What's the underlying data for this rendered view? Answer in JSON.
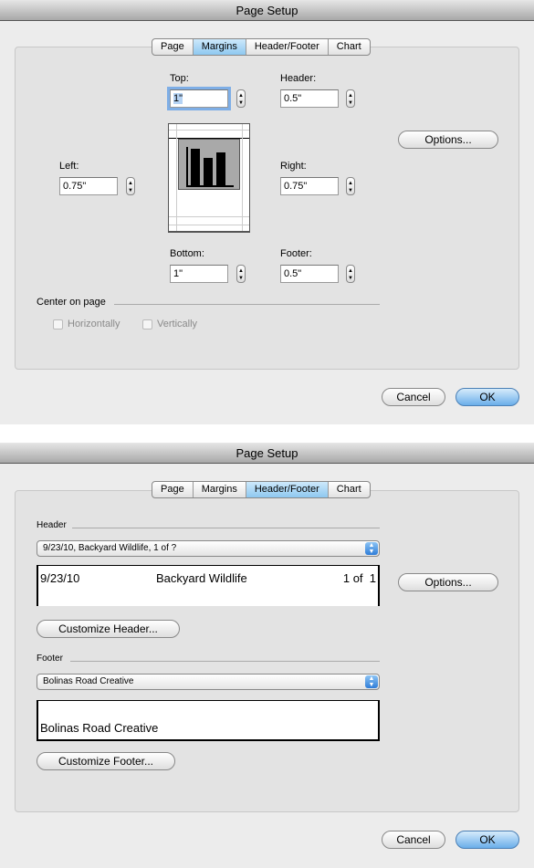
{
  "dialog1": {
    "title": "Page Setup",
    "tabs": [
      "Page",
      "Margins",
      "Header/Footer",
      "Chart"
    ],
    "selected_tab": "Margins",
    "top_label": "Top:",
    "top_value": "1\"",
    "header_label": "Header:",
    "header_value": "0.5\"",
    "left_label": "Left:",
    "left_value": "0.75\"",
    "right_label": "Right:",
    "right_value": "0.75\"",
    "bottom_label": "Bottom:",
    "bottom_value": "1\"",
    "footer_label": "Footer:",
    "footer_value": "0.5\"",
    "options_label": "Options...",
    "center_label": "Center on page",
    "horizontally_label": "Horizontally",
    "vertically_label": "Vertically",
    "cancel_label": "Cancel",
    "ok_label": "OK"
  },
  "dialog2": {
    "title": "Page Setup",
    "tabs": [
      "Page",
      "Margins",
      "Header/Footer",
      "Chart"
    ],
    "selected_tab": "Header/Footer",
    "header_section": "Header",
    "header_popup": "9/23/10, Backyard Wildlife, 1 of  ?",
    "header_preview": {
      "left": "9/23/10",
      "center": "Backyard Wildlife",
      "right": "1 of  1"
    },
    "options_label": "Options...",
    "customize_header_label": "Customize Header...",
    "footer_section": "Footer",
    "footer_popup": "Bolinas Road Creative",
    "footer_preview": "Bolinas Road Creative",
    "customize_footer_label": "Customize Footer...",
    "cancel_label": "Cancel",
    "ok_label": "OK"
  }
}
